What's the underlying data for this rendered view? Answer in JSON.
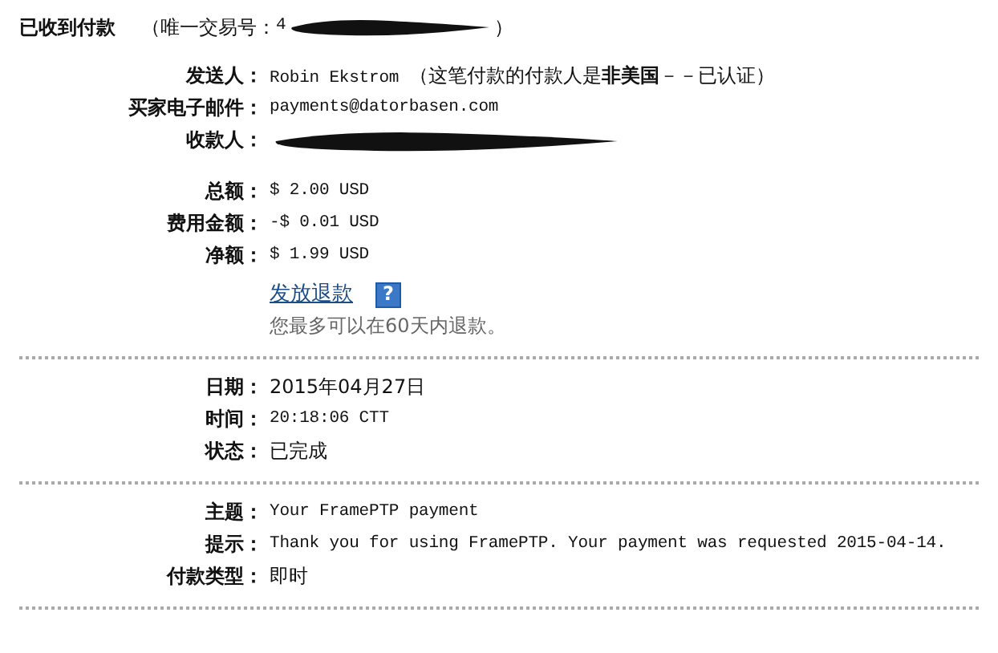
{
  "header": {
    "title": "已收到付款",
    "txn_label": "（唯一交易号：",
    "txn_value": "4",
    "txn_redacted": true,
    "txn_close": "）"
  },
  "sections": [
    {
      "rows": [
        {
          "label": "发送人：",
          "value": "Robin Ekstrom  （这笔付款的付款人是**非美国**－－已认证）",
          "kind": "text"
        },
        {
          "label": "买家电子邮件：",
          "value": "payments@datorbasen.com",
          "kind": "mono"
        },
        {
          "label": "收款人：",
          "kind": "redacted"
        }
      ]
    },
    {
      "rows": [
        {
          "label": "总额：",
          "value": "$ 2.00 USD",
          "kind": "mono"
        },
        {
          "label": "费用金额：",
          "value": "-$ 0.01 USD",
          "kind": "mono"
        },
        {
          "label": "净额：",
          "value": "$ 1.99 USD",
          "kind": "mono"
        }
      ],
      "link": "发放退款",
      "help_icon": "?",
      "note": "您最多可以在60天内退款。"
    },
    {
      "rows": [
        {
          "label": "日期：",
          "value": "2015年04月27日",
          "kind": "text"
        },
        {
          "label": "时间：",
          "value": "20:18:06 CTT",
          "kind": "mono"
        },
        {
          "label": "状态：",
          "value": "已完成",
          "kind": "text"
        }
      ]
    },
    {
      "rows": [
        {
          "label": "主题：",
          "value": "Your FramePTP payment",
          "kind": "mono"
        },
        {
          "label": "提示：",
          "value": "Thank you for using FramePTP. Your payment was requested 2015-04-14.",
          "kind": "mono"
        },
        {
          "label": "付款类型：",
          "value": "即时",
          "kind": "text"
        }
      ]
    }
  ]
}
